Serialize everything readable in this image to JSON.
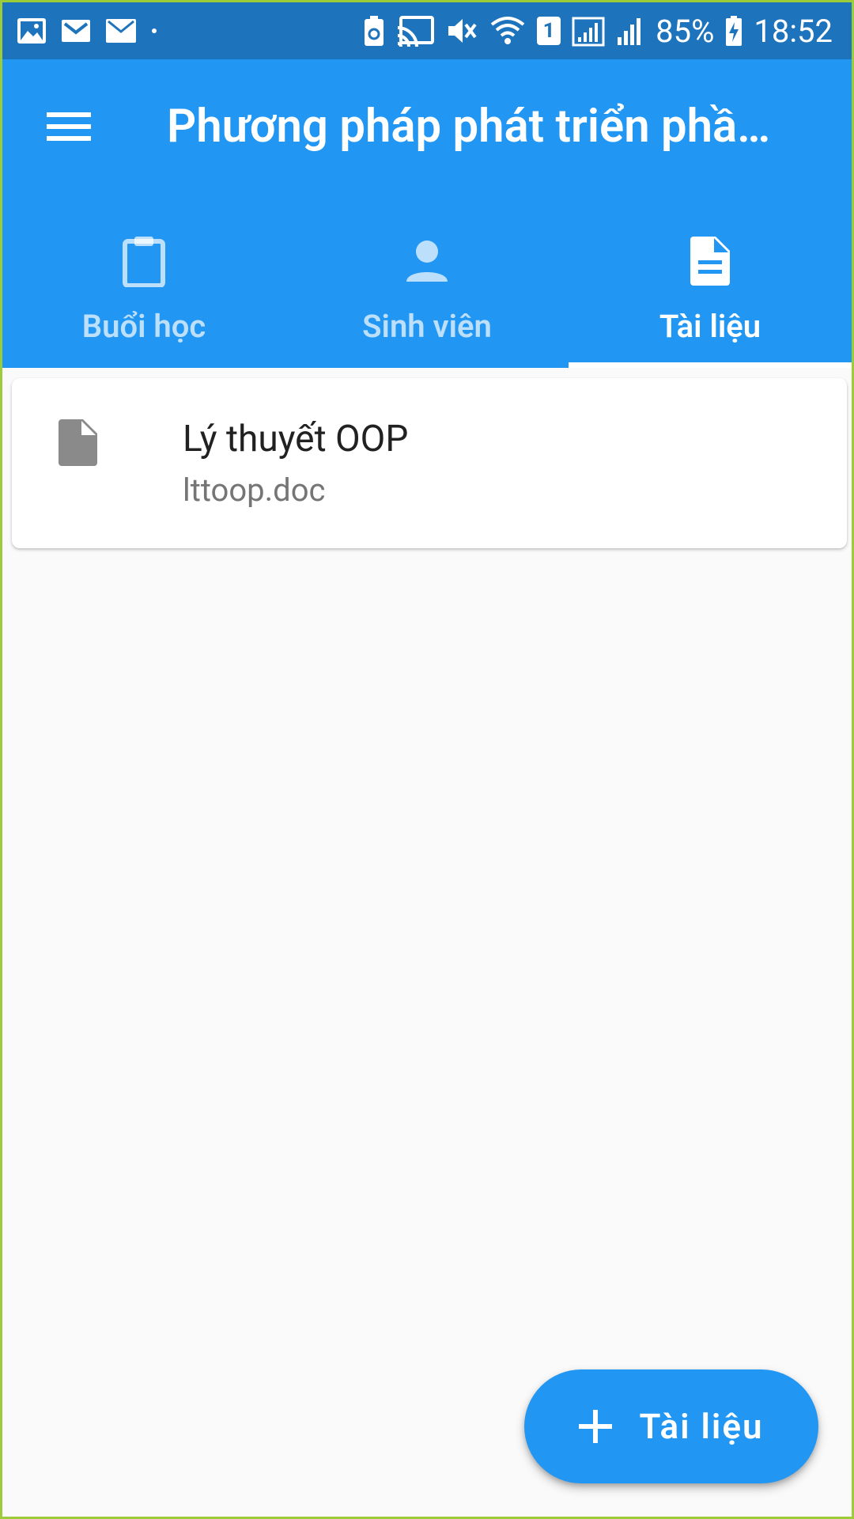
{
  "status_bar": {
    "battery": "85%",
    "time": "18:52",
    "sim_slot": "1"
  },
  "toolbar": {
    "title": "Phương pháp phát triển phầ…"
  },
  "tabs": [
    {
      "label": "Buổi học",
      "icon": "clipboard-icon",
      "active": false
    },
    {
      "label": "Sinh viên",
      "icon": "person-icon",
      "active": false
    },
    {
      "label": "Tài liệu",
      "icon": "document-icon",
      "active": true
    }
  ],
  "documents": [
    {
      "title": "Lý thuyết OOP",
      "file": "lttoop.doc",
      "icon": "file-icon"
    }
  ],
  "fab": {
    "label": "Tài liệu",
    "icon": "plus-icon"
  },
  "colors": {
    "primary": "#2196f3",
    "status_bar": "#1e73bd",
    "background": "#fafafa"
  }
}
